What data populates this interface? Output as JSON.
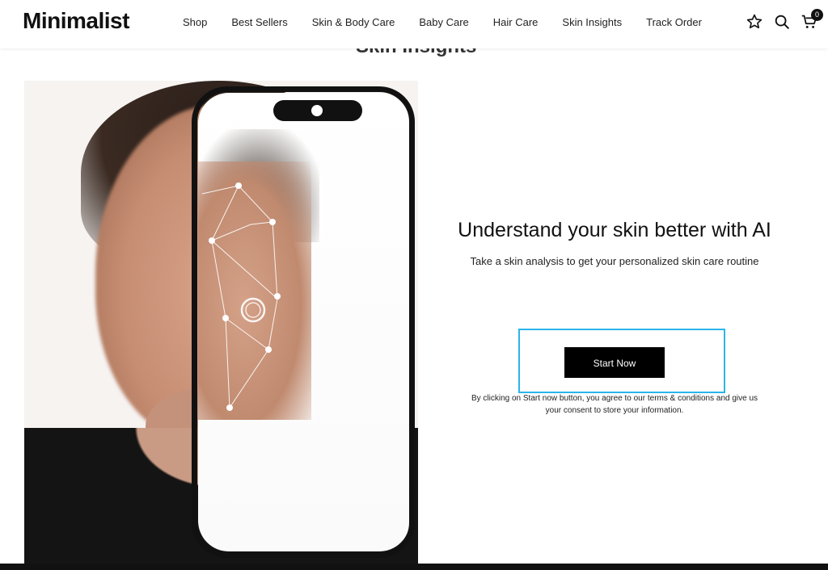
{
  "header": {
    "logo": "Minimalist",
    "nav": [
      "Shop",
      "Best Sellers",
      "Skin & Body Care",
      "Baby Care",
      "Hair Care",
      "Skin Insights",
      "Track Order"
    ],
    "cart_count": "0",
    "icons": [
      "star-icon",
      "search-icon",
      "cart-icon"
    ]
  },
  "section": {
    "heading": "Skin Insights"
  },
  "hero": {
    "title": "Understand your skin better with AI",
    "subtitle": "Take a skin analysis to get your personalized skin care routine",
    "cta_label": "Start Now",
    "consent": "By clicking on Start now button, you agree to our terms & conditions and give us your consent to store your information."
  },
  "colors": {
    "focus_outline": "#2bb5ea",
    "button_bg": "#000000",
    "text": "#111111"
  }
}
